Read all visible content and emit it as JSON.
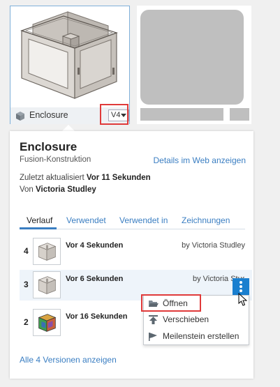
{
  "thumbnail": {
    "name": "Enclosure",
    "version": "V4"
  },
  "details": {
    "title": "Enclosure",
    "subtitle": "Fusion-Konstruktion",
    "web_link": "Details im Web anzeigen",
    "updated_label": "Zuletzt aktualisiert",
    "updated_value": "Vor 11 Sekunden",
    "by_label": "Von",
    "by_value": "Victoria Studley"
  },
  "tabs": [
    "Verlauf",
    "Verwendet",
    "Verwendet in",
    "Zeichnungen"
  ],
  "versions": [
    {
      "num": "4",
      "time": "Vor 4 Sekunden",
      "by": "by Victoria Studley"
    },
    {
      "num": "3",
      "time": "Vor 6 Sekunden",
      "by": "by Victoria Studley"
    },
    {
      "num": "2",
      "time": "Vor 16 Sekunden",
      "by": ""
    }
  ],
  "context_menu": [
    "Öffnen",
    "Verschieben",
    "Meilenstein erstellen"
  ],
  "all_versions_link": "Alle 4 Versionen anzeigen",
  "colors": {
    "accent": "#1a7fcf",
    "link": "#3a7ec2",
    "highlight": "#e03a3a"
  }
}
